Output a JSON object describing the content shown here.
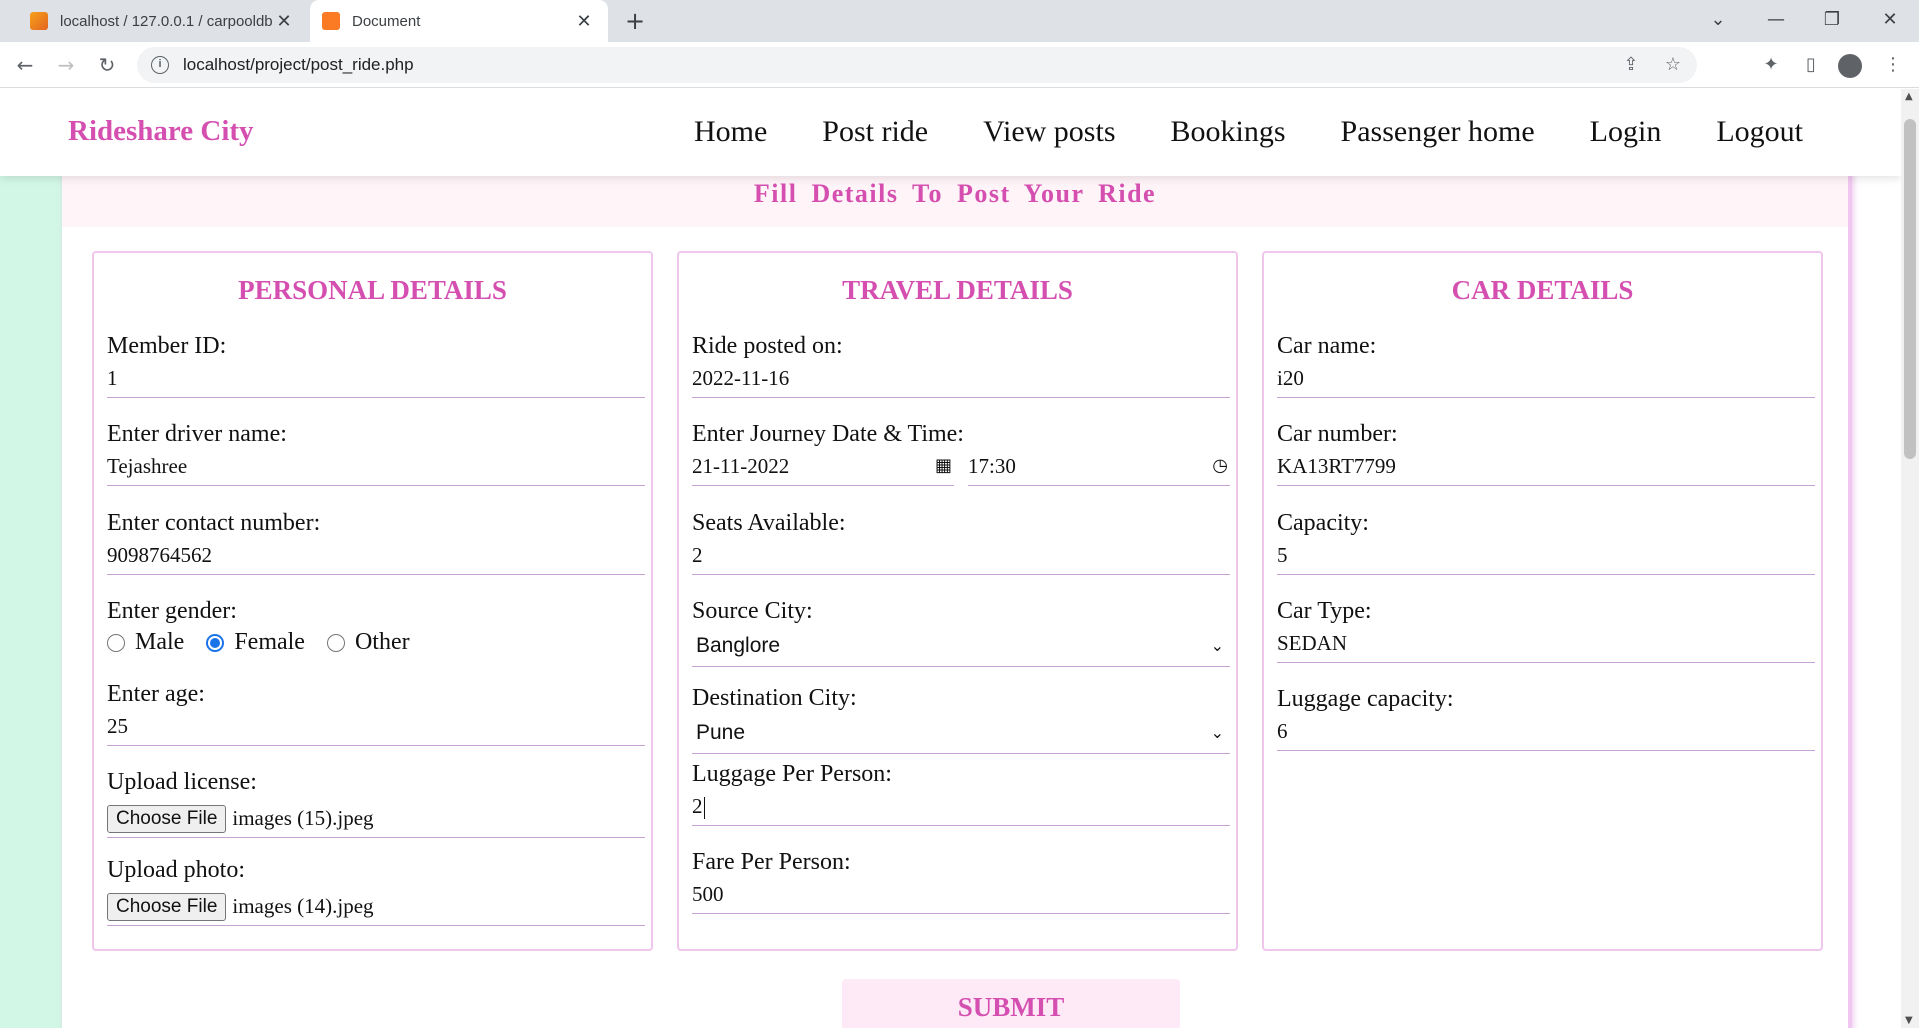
{
  "browser": {
    "tabs": [
      {
        "title": "localhost / 127.0.0.1 / carpooldb",
        "active": false
      },
      {
        "title": "Document",
        "active": true
      }
    ],
    "url": "localhost/project/post_ride.php"
  },
  "navbar": {
    "brand": "Rideshare City",
    "links": [
      "Home",
      "Post ride",
      "View posts",
      "Bookings",
      "Passenger home",
      "Login",
      "Logout"
    ]
  },
  "page_title": "Fill Details To Post Your Ride",
  "personal": {
    "heading": "PERSONAL DETAILS",
    "member_id_label": "Member ID:",
    "member_id": "1",
    "driver_name_label": "Enter driver name:",
    "driver_name": "Tejashree",
    "contact_label": "Enter contact number:",
    "contact": "9098764562",
    "gender_label": "Enter gender:",
    "gender_options": [
      "Male",
      "Female",
      "Other"
    ],
    "gender_selected": "Female",
    "age_label": "Enter age:",
    "age": "25",
    "license_label": "Upload license:",
    "license_file": "images (15).jpeg",
    "photo_label": "Upload photo:",
    "photo_file": "images (14).jpeg",
    "choose_file": "Choose File"
  },
  "travel": {
    "heading": "TRAVEL DETAILS",
    "posted_label": "Ride posted on:",
    "posted": "2022-11-16",
    "journey_label": "Enter Journey Date & Time:",
    "journey_date": "21-11-2022",
    "journey_time": "17:30",
    "seats_label": "Seats Available:",
    "seats": "2",
    "source_label": "Source City:",
    "source": "Banglore",
    "destination_label": "Destination City:",
    "destination": "Pune",
    "luggage_label": "Luggage Per Person:",
    "luggage": "2",
    "fare_label": "Fare Per Person:",
    "fare": "500"
  },
  "car": {
    "heading": "CAR DETAILS",
    "name_label": "Car name:",
    "name": "i20",
    "number_label": "Car number:",
    "number": "KA13RT7799",
    "capacity_label": "Capacity:",
    "capacity": "5",
    "type_label": "Car Type:",
    "type": "SEDAN",
    "luggage_label": "Luggage capacity:",
    "luggage": "6"
  },
  "submit_label": "SUBMIT",
  "colors": {
    "accent": "#d44fb0",
    "green_strip": "#d2f7e6"
  }
}
